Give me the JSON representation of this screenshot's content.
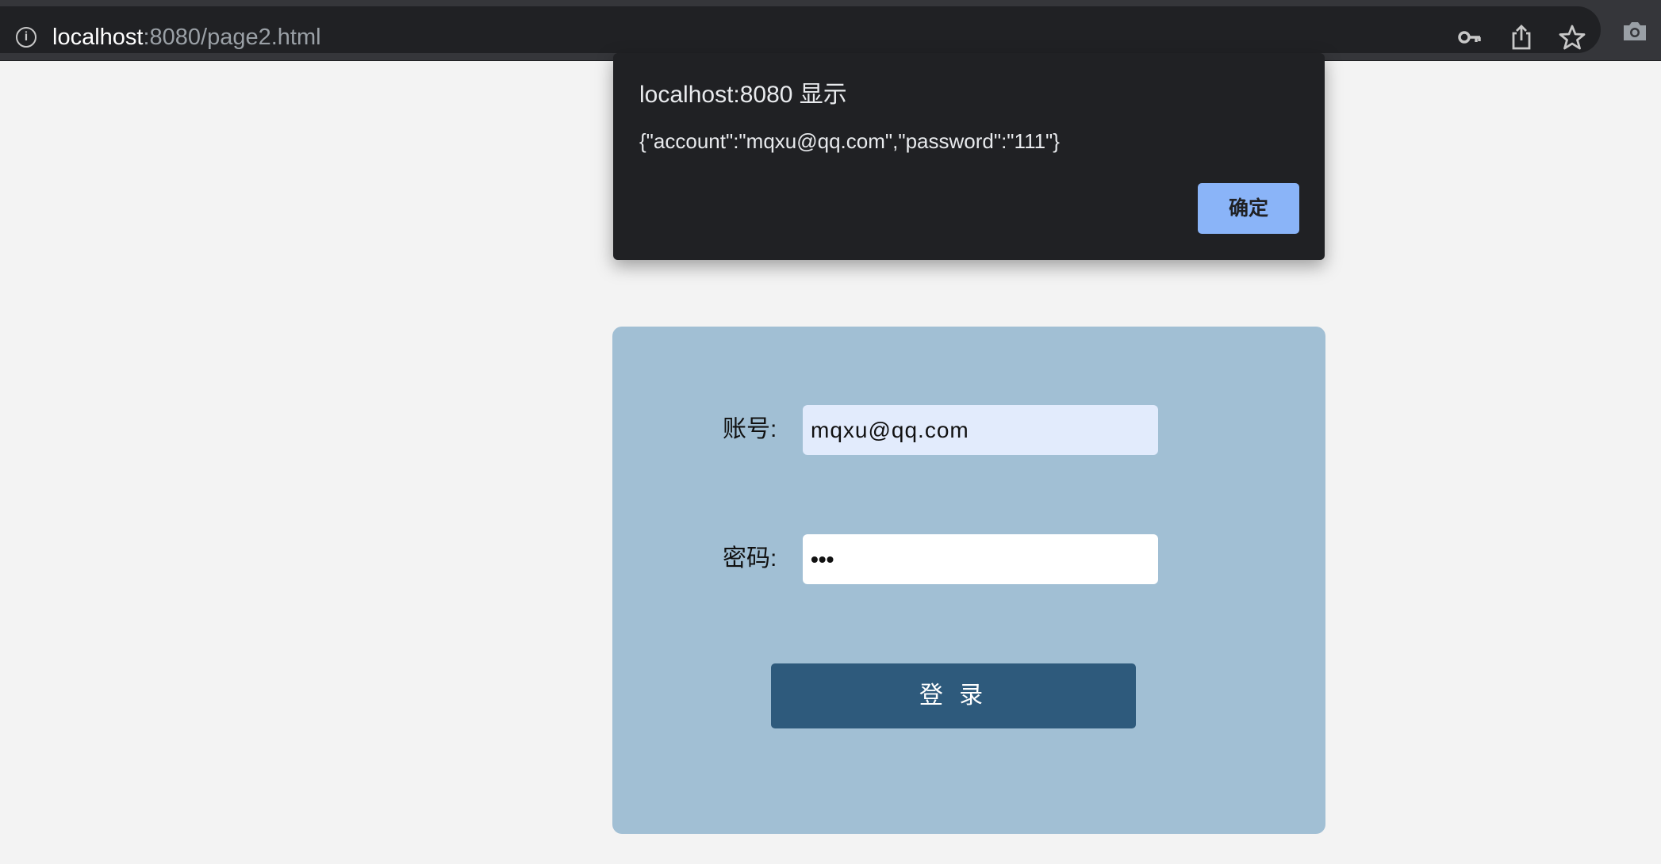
{
  "browser": {
    "url_host": "localhost",
    "url_path": ":8080/page2.html",
    "icons": [
      "info-icon",
      "key-icon",
      "share-icon",
      "star-icon",
      "camera-icon"
    ]
  },
  "alert": {
    "title": "localhost:8080 显示",
    "message": "{\"account\":\"mqxu@qq.com\",\"password\":\"111\"}",
    "ok_label": "确定"
  },
  "login_form": {
    "account_label": "账号:",
    "account_value": "mqxu@qq.com",
    "password_label": "密码:",
    "password_mask": "•••",
    "submit_label": "登 录"
  },
  "colors": {
    "page_background": "#f3f3f3",
    "card_background": "#a1bfd4",
    "button_background": "#2e5a7c",
    "autofill_background": "#e2ebfc",
    "dialog_background": "#202124",
    "dialog_button": "#8ab4f8"
  }
}
